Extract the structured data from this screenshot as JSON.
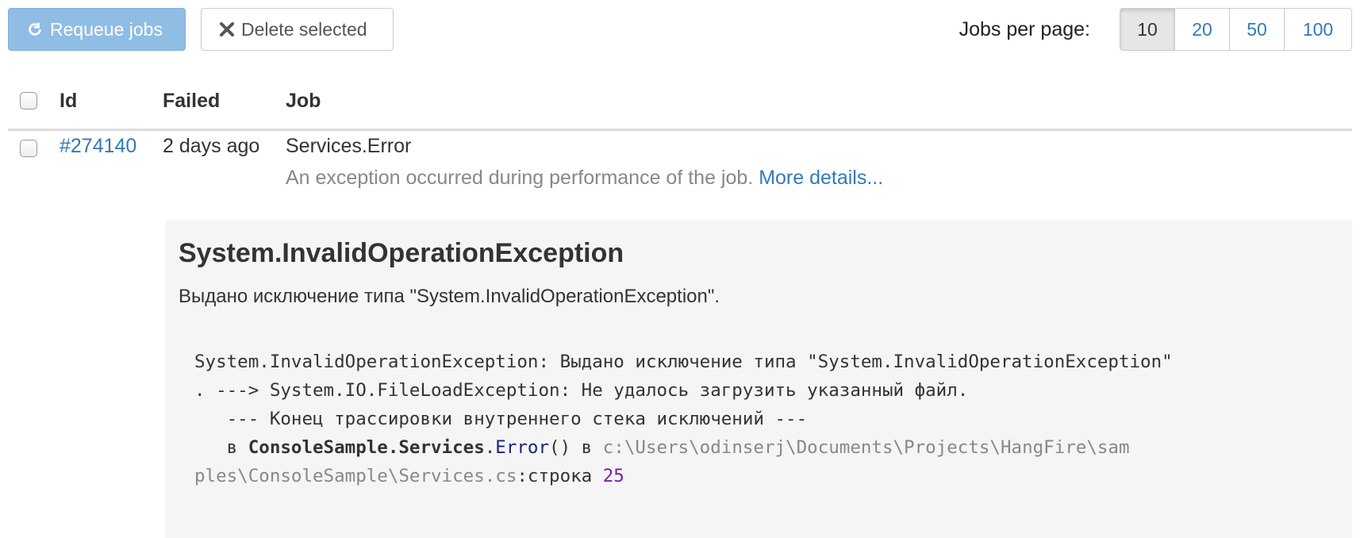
{
  "toolbar": {
    "requeue_label": "Requeue jobs",
    "delete_label": "Delete selected",
    "per_page_label": "Jobs per page:",
    "page_sizes": [
      "10",
      "20",
      "50",
      "100"
    ],
    "active_page_size": "10"
  },
  "table": {
    "headers": {
      "id": "Id",
      "failed": "Failed",
      "job": "Job"
    },
    "rows": [
      {
        "id": "#274140",
        "failed": "2 days ago",
        "job": "Services.Error",
        "summary": "An exception occurred during performance of the job.",
        "more_link": "More details..."
      }
    ]
  },
  "details": {
    "exception_type": "System.InvalidOperationException",
    "exception_message": "Выдано исключение типа \"System.InvalidOperationException\".",
    "trace": {
      "line1": "System.InvalidOperationException: Выдано исключение типа \"System.InvalidOperationException\"",
      "line2": ". ---> System.IO.FileLoadException: Не удалось загрузить указанный файл.",
      "line3": "   --- Конец трассировки внутреннего стека исключений ---",
      "line4_prefix": "   в ",
      "line4_class": "ConsoleSample.Services",
      "line4_dot": ".",
      "line4_method": "Error",
      "line4_parens": "()",
      "line4_in": " в ",
      "line4_path": "c:\\Users\\odinserj\\Documents\\Projects\\HangFire\\sam",
      "line5_path": "ples\\ConsoleSample\\Services.cs",
      "line5_sep": ":строка ",
      "line5_num": "25"
    }
  }
}
